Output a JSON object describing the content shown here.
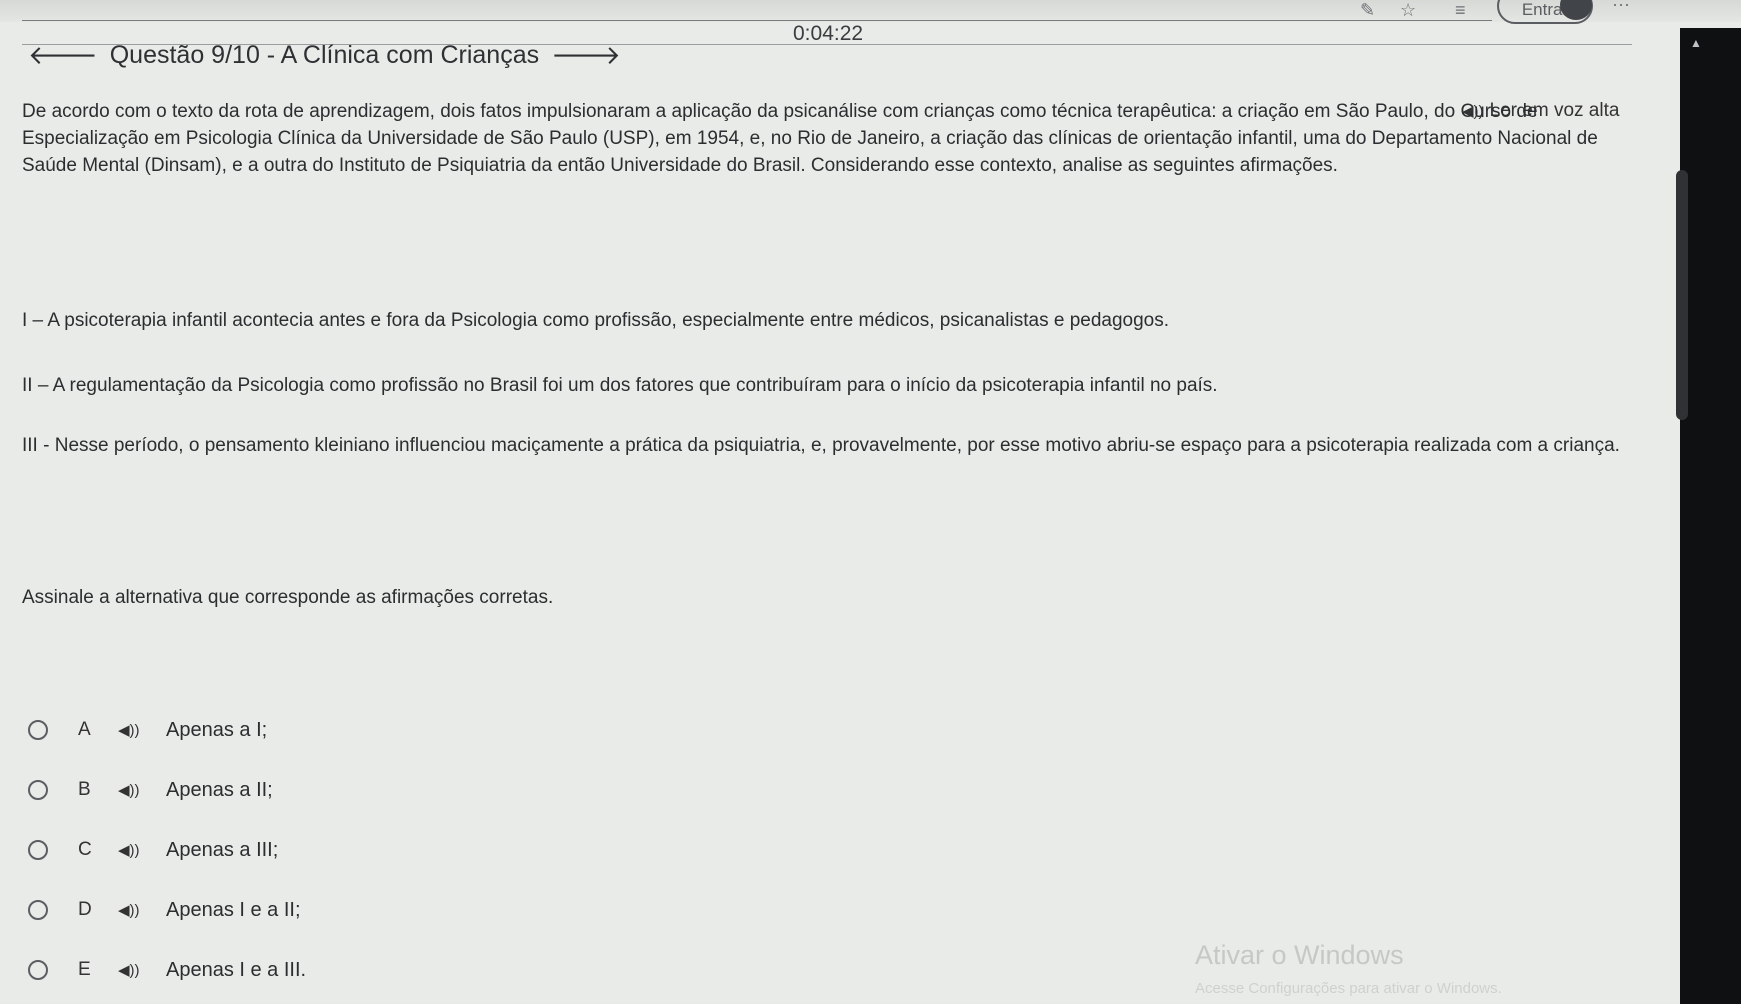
{
  "top": {
    "timer": "0:04:22",
    "signin_label": "Entrar",
    "more_label": "···"
  },
  "question": {
    "header": "Questão 9/10 - A Clínica com Crianças",
    "read_aloud": "Ler em voz alta",
    "intro": "De acordo com o texto da rota de aprendizagem, dois fatos impulsionaram a aplicação da psicanálise com crianças como técnica terapêutica: a criação em São Paulo, do Curso de Especialização em Psicologia Clínica da Universidade de São Paulo (USP), em 1954, e, no Rio de Janeiro, a criação das clínicas de orientação infantil, uma do Departamento Nacional de Saúde Mental (Dinsam), e a outra do Instituto de Psiquiatria da então Universidade do Brasil. Considerando esse contexto, analise as seguintes afirmações.",
    "statements": [
      "I – A psicoterapia infantil acontecia antes e fora da Psicologia como profissão, especialmente entre médicos, psicanalistas e pedagogos.",
      "II – A regulamentação da Psicologia como profissão no Brasil foi um dos fatores que contribuíram para o início da psicoterapia infantil no país.",
      "III - Nesse período, o pensamento kleiniano influenciou maciçamente a prática da psiquiatria, e, provavelmente, por esse motivo abriu-se espaço para a psicoterapia realizada com a criança."
    ],
    "prompt": "Assinale a alternativa que corresponde as afirmações corretas.",
    "options": [
      {
        "letter": "A",
        "text": "Apenas a I;"
      },
      {
        "letter": "B",
        "text": "Apenas a II;"
      },
      {
        "letter": "C",
        "text": "Apenas a III;"
      },
      {
        "letter": "D",
        "text": "Apenas I e a II;"
      },
      {
        "letter": "E",
        "text": "Apenas I e a III."
      }
    ]
  },
  "watermark": {
    "title": "Ativar o Windows",
    "subtitle": "Acesse Configurações para ativar o Windows."
  },
  "icons": {
    "back": "arrow-left-icon",
    "next": "arrow-right-icon",
    "speaker": "speaker-icon",
    "scroll_up": "caret-up-icon"
  }
}
